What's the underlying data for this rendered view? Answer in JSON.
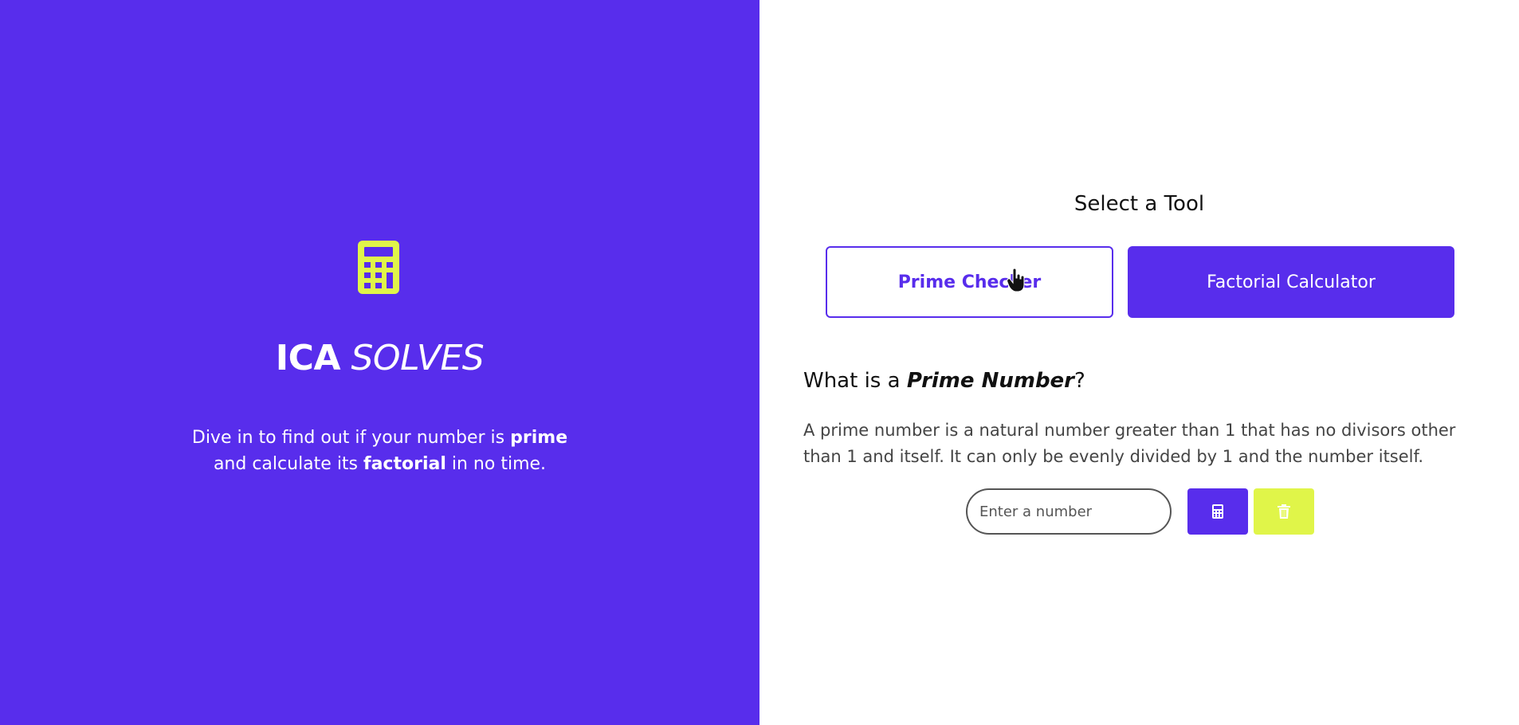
{
  "colors": {
    "brand_purple": "#582dec",
    "accent_yellow": "#e0f549",
    "panel_white": "#ffffff"
  },
  "hero": {
    "logo_icon": "calculator-icon",
    "brand_bold": "ICA",
    "brand_italic": "SOLVES",
    "tagline_line1_pre": "Dive in to find out if your number is ",
    "tagline_line1_bold": "prime",
    "tagline_line2_pre": "and calculate its ",
    "tagline_line2_bold": "factorial",
    "tagline_line2_post": " in no time."
  },
  "tools": {
    "title": "Select a Tool",
    "prime_label": "Prime Checker",
    "factorial_label": "Factorial Calculator",
    "selected": "Prime Checker"
  },
  "section": {
    "title_pre": "What is a ",
    "title_em": "Prime Number",
    "title_post": "?",
    "description": "A prime number is a natural number greater than 1 that has no divisors other than 1 and itself. It can only be evenly divided by 1 and the number itself."
  },
  "form": {
    "input_value": "",
    "input_placeholder": "Enter a number",
    "calculate_icon": "calculator-icon",
    "clear_icon": "trash-icon"
  }
}
